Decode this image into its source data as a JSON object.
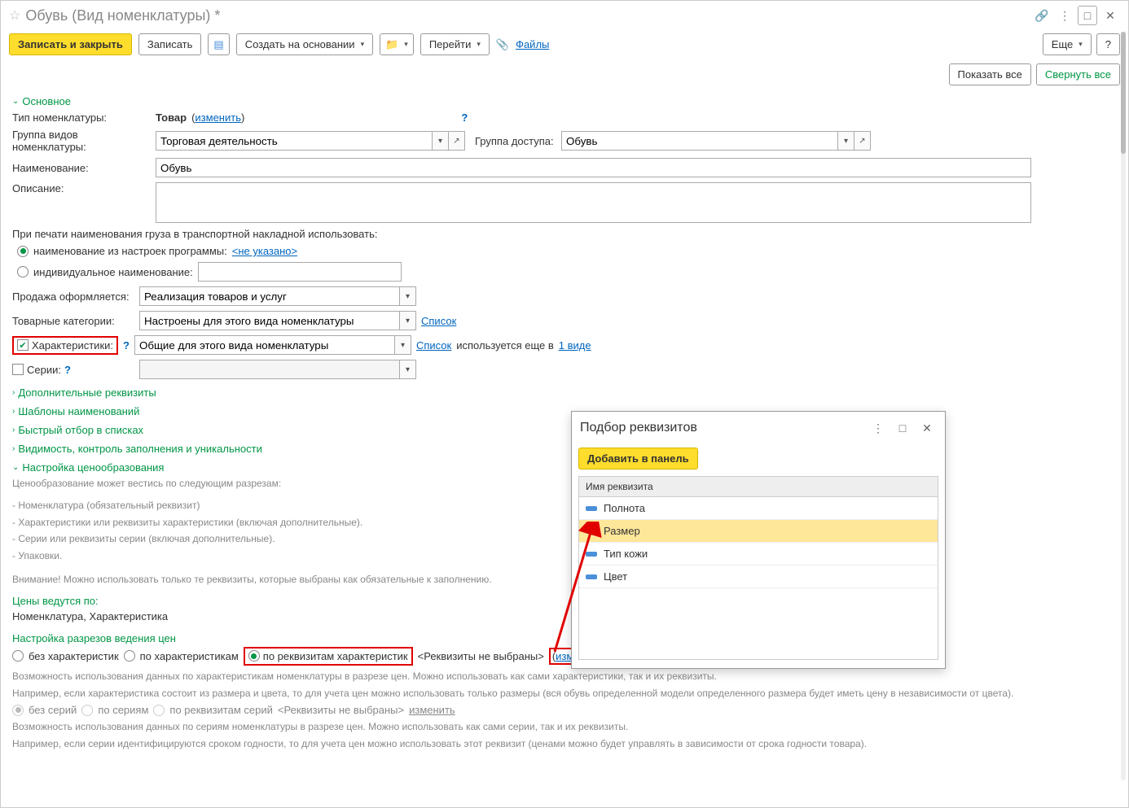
{
  "titlebar": {
    "title": "Обувь (Вид номенклатуры) *"
  },
  "toolbar": {
    "save_close": "Записать и закрыть",
    "save": "Записать",
    "create": "Создать на основании",
    "goto": "Перейти",
    "files": "Файлы",
    "more": "Еще",
    "help": "?"
  },
  "morebar": {
    "show_all": "Показать все",
    "collapse_all": "Свернуть все"
  },
  "sections": {
    "main": "Основное",
    "extra": "Дополнительные реквизиты",
    "tpl": "Шаблоны наименований",
    "quick": "Быстрый отбор в списках",
    "vis": "Видимость, контроль заполнения и уникальности",
    "price": "Настройка ценообразования"
  },
  "main": {
    "type_l": "Тип номенклатуры:",
    "type_v": "Товар",
    "type_change": "изменить",
    "group_l": "Группа видов номенклатуры:",
    "group_v": "Торговая деятельность",
    "access_l": "Группа доступа:",
    "access_v": "Обувь",
    "name_l": "Наименование:",
    "name_v": "Обувь",
    "desc_l": "Описание:",
    "print_l": "При печати наименования груза в транспортной накладной использовать:",
    "print_r1": "наименование из настроек программы:",
    "print_r1v": "<не указано>",
    "print_r2": "индивидуальное наименование:",
    "sale_l": "Продажа оформляется:",
    "sale_v": "Реализация товаров и услуг",
    "cat_l": "Товарные категории:",
    "cat_v": "Настроены для этого вида номенклатуры",
    "cat_lnk": "Список",
    "char_l": "Характеристики:",
    "char_v": "Общие для этого вида номенклатуры",
    "char_lnk": "Список",
    "char_txt": "используется еще в",
    "char_lnk2": "1 виде",
    "ser_l": "Серии:"
  },
  "price": {
    "intro": "Ценообразование может вестись по следующим разрезам:",
    "b1": "- Номенклатура (обязательный реквизит)",
    "b2": "- Характеристики или реквизиты характеристики (включая дополнительные).",
    "b3": "- Серии или реквизиты серии (включая дополнительные).",
    "b4": "- Упаковки.",
    "warn": "Внимание! Можно использовать только те реквизиты, которые выбраны как обязательные к заполнению.",
    "by_h": "Цены ведутся по:",
    "by_v": "Номенклатура, Характеристика",
    "cut_h": "Настройка разрезов ведения цен",
    "r1": "без характеристик",
    "r2": "по характеристикам",
    "r3": "по реквизитам характеристик",
    "not_sel": "<Реквизиты не выбраны>",
    "change": "изменить",
    "note1": "Возможность использования данных по характеристикам номенклатуры в разрезе цен. Можно использовать как сами характеристики, так и их реквизиты.",
    "note2": "Например, если характеристика состоит из размера и цвета, то для учета цен можно использовать только размеры (вся обувь определенной модели определенного размера будет иметь цену в независимости от цвета).",
    "s1": "без серий",
    "s2": "по сериям",
    "s3": "по реквизитам серий",
    "snot": "<Реквизиты не выбраны>",
    "schange": "изменить",
    "note3": "Возможность использования данных по сериям номенклатуры в разрезе цен. Можно использовать как сами серии, так и их реквизиты.",
    "note4": "Например, если серии идентифицируются сроком годности, то для учета цен можно использовать этот реквизит (ценами можно будет управлять в зависимости от срока годности товара)."
  },
  "popup": {
    "title": "Подбор реквизитов",
    "add": "Добавить в панель",
    "col": "Имя реквизита",
    "rows": [
      "Полнота",
      "Размер",
      "Тип кожи",
      "Цвет"
    ]
  }
}
